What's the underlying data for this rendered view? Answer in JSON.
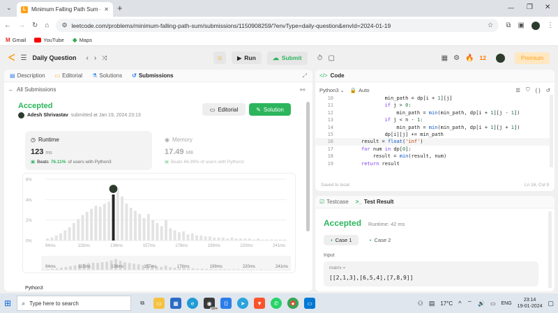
{
  "browser": {
    "tab_title": "Minimum Falling Path Sum - L",
    "tab_close": "✕",
    "new_tab": "+",
    "url": "leetcode.com/problems/minimum-falling-path-sum/submissions/1150908259/?envType=daily-question&envId=2024-01-19",
    "window_min": "—",
    "window_max": "❐",
    "window_close": "✕"
  },
  "bookmarks": [
    {
      "label": "Gmail"
    },
    {
      "label": "YouTube"
    },
    {
      "label": "Maps"
    }
  ],
  "lc_header": {
    "daily_question": "Daily Question",
    "run": "Run",
    "submit": "Submit",
    "streak_count": "12",
    "premium": "Premium"
  },
  "left": {
    "tabs": [
      {
        "label": "Description"
      },
      {
        "label": "Editorial"
      },
      {
        "label": "Solutions"
      },
      {
        "label": "Submissions"
      }
    ],
    "all_submissions": "All Submissions",
    "status": "Accepted",
    "user": "Adesh Shrivastav",
    "submitted_text": "submitted at Jan 19, 2024 23:13",
    "editorial_btn": "Editorial",
    "solution_btn": "Solution",
    "runtime_label": "Runtime",
    "runtime_value": "123",
    "runtime_unit": "ms",
    "runtime_beats_prefix": "Beats",
    "runtime_beats_pct": "76.11%",
    "runtime_beats_suffix": "of users with Python3",
    "memory_label": "Memory",
    "memory_value": "17.49",
    "memory_unit": "MB",
    "memory_beats": "Beats 66.99% of users with Python3",
    "language": "Python3"
  },
  "chart_data": {
    "type": "bar",
    "y_ticks": [
      "6%",
      "4%",
      "2%",
      "0%"
    ],
    "x_ticks": [
      "94ms",
      "115ms",
      "136ms",
      "157ms",
      "178ms",
      "199ms",
      "220ms",
      "241ms"
    ],
    "mini_ticks": [
      "94ms",
      "115ms",
      "136ms",
      "157ms",
      "178ms",
      "199ms",
      "220ms",
      "241ms"
    ],
    "ylim": [
      0,
      6
    ],
    "values": [
      0.2,
      0.3,
      0.5,
      0.7,
      1.0,
      1.3,
      1.7,
      2.1,
      2.5,
      2.8,
      3.1,
      3.4,
      3.3,
      3.6,
      3.8,
      4.5,
      5.2,
      4.3,
      3.6,
      3.2,
      2.9,
      2.6,
      2.2,
      2.6,
      2.0,
      1.7,
      1.4,
      2.0,
      1.2,
      1.0,
      0.8,
      0.9,
      0.6,
      0.7,
      0.5,
      0.5,
      0.4,
      0.4,
      0.3,
      0.3,
      0.3,
      0.2,
      0.3,
      0.2,
      0.2,
      0.2,
      0.2,
      0.1,
      0.2,
      0.1,
      0.1,
      0.1,
      0.1,
      0.1,
      0.1
    ],
    "highlight_index": 15
  },
  "code": {
    "tab_label": "Code",
    "language": "Python3",
    "mode": "Auto",
    "saved": "Saved to local",
    "cursor": "Ln 16, Col 9",
    "lines": [
      {
        "n": "10",
        "indent": 8,
        "text": "min_path = dp[i + 1][j]"
      },
      {
        "n": "11",
        "indent": 8,
        "text": "if j > 0:"
      },
      {
        "n": "12",
        "indent": 12,
        "text": "min_path = min(min_path, dp[i + 1][j - 1])"
      },
      {
        "n": "13",
        "indent": 8,
        "text": "if j < n - 1:"
      },
      {
        "n": "14",
        "indent": 12,
        "text": "min_path = min(min_path, dp[i + 1][j + 1])"
      },
      {
        "n": "15",
        "indent": 8,
        "text": "dp[i][j] += min_path"
      },
      {
        "n": "16",
        "indent": 0,
        "text": "result = float('inf')"
      },
      {
        "n": "17",
        "indent": 0,
        "text": "for num in dp[0]:"
      },
      {
        "n": "18",
        "indent": 4,
        "text": "result = min(result, num)"
      },
      {
        "n": "19",
        "indent": 0,
        "text": "return result"
      }
    ]
  },
  "test": {
    "testcase_tab": "Testcase",
    "result_tab": "Test Result",
    "status": "Accepted",
    "runtime": "Runtime: 42 ms",
    "case1": "Case 1",
    "case2": "Case 2",
    "input_label": "Input",
    "var_name": "matrix =",
    "var_value": "[[2,1,3],[6,5,4],[7,8,9]]"
  },
  "taskbar": {
    "search_placeholder": "Type here to search",
    "badge": "99+",
    "weather": "17°C",
    "lang": "ENG",
    "time": "23:14",
    "date": "19-01-2024"
  }
}
